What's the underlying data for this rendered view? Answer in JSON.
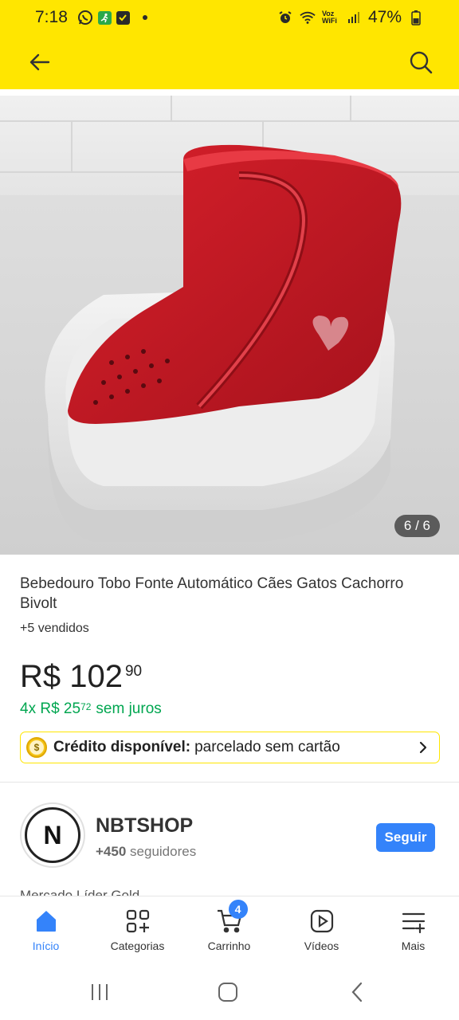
{
  "status_bar": {
    "time": "7:18",
    "network_label": "Voz WiFi",
    "battery": "47%"
  },
  "header": {
    "back_icon": "arrow-left-icon",
    "search_icon": "search-icon"
  },
  "gallery": {
    "counter": "6 / 6"
  },
  "product": {
    "title": "Bebedouro Tobo Fonte Automático Cães Gatos Cachorro Bivolt",
    "sold": "+5 vendidos",
    "price_main": "R$ 102",
    "price_cents": "90",
    "installments_prefix": "4x R$ 25",
    "installments_cents": "72",
    "installments_suffix": "sem juros",
    "credit_label": "Crédito disponível:",
    "credit_text": "parcelado sem cartão"
  },
  "seller": {
    "logo_letter": "N",
    "name": "NBTSHOP",
    "followers_count": "+450",
    "followers_label": "seguidores",
    "follow_label": "Seguir"
  },
  "peek_text": "Mercado Líder Gold",
  "bottom_nav": {
    "items": [
      {
        "label": "Início",
        "icon": "home-icon",
        "active": true
      },
      {
        "label": "Categorias",
        "icon": "categories-icon"
      },
      {
        "label": "Carrinho",
        "icon": "cart-icon",
        "badge": "4"
      },
      {
        "label": "Vídeos",
        "icon": "play-icon"
      },
      {
        "label": "Mais",
        "icon": "menu-plus-icon"
      }
    ]
  },
  "colors": {
    "brand_yellow": "#ffe600",
    "accent_blue": "#3483fa",
    "green": "#00a650"
  }
}
